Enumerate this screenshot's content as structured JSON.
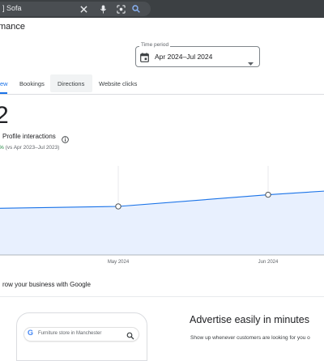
{
  "search_bar": {
    "query": "] Sofa"
  },
  "header": {
    "title": "mance"
  },
  "time_period": {
    "label": "Time period",
    "value": "Apr 2024–Jul 2024"
  },
  "tabs": [
    {
      "label": "ew"
    },
    {
      "label": "Bookings"
    },
    {
      "label": "Directions"
    },
    {
      "label": "Website clicks"
    }
  ],
  "metric": {
    "value": "2",
    "label": "Profile interactions",
    "change_pct": "%",
    "comparison": "(vs Apr 2023–Jul 2023)"
  },
  "chart_data": {
    "type": "area",
    "x": [
      "",
      "May 2024",
      "Jun 2024",
      ""
    ],
    "values": [
      24,
      25,
      31,
      33
    ],
    "tick_labels": [
      "May 2024",
      "Jun 2024"
    ],
    "title": "",
    "xlabel": "",
    "ylabel": "",
    "ylim": [
      0,
      50
    ],
    "grid": true,
    "line_color": "#1a73e8",
    "fill_color": "#e8f0fe"
  },
  "grow": {
    "title": "row your business with Google"
  },
  "phone": {
    "search_query": "Furniture store in Manchester",
    "logo": "G"
  },
  "advertise": {
    "title": "Advertise easily in minutes",
    "body": "Show up whenever customers are looking for you o"
  },
  "colors": {
    "accent": "#1a73e8",
    "positive": "#188038",
    "topbar": "#3c4043"
  }
}
